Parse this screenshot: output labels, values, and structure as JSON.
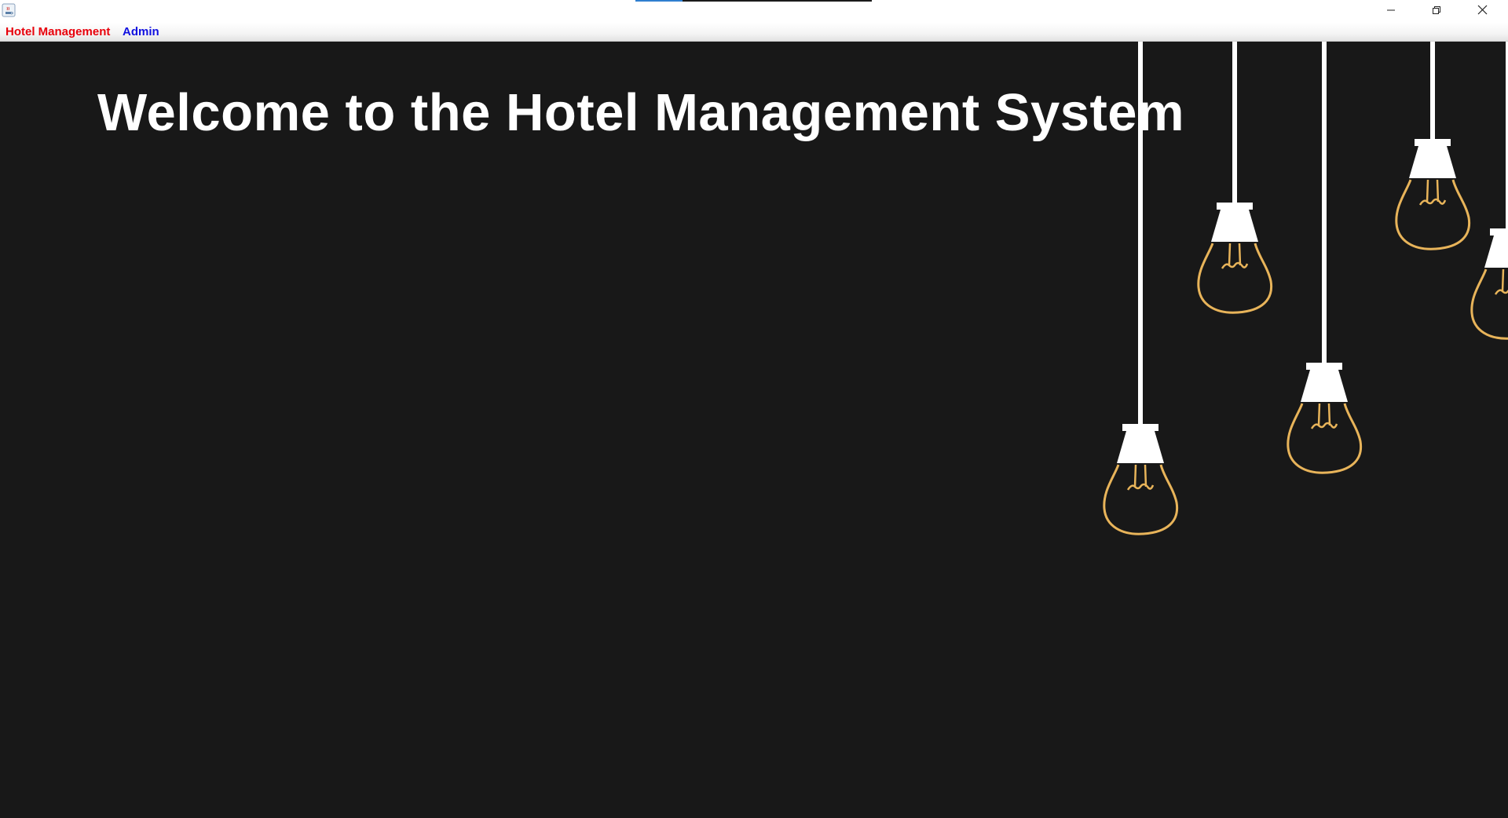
{
  "window": {
    "app_icon": "java-cup-icon",
    "loading_progress": 0.2,
    "controls": {
      "minimize_icon": "minimize-icon",
      "maximize_icon": "restore-icon",
      "close_icon": "close-icon"
    }
  },
  "menubar": {
    "items": [
      {
        "label": "Hotel Management",
        "color": "#e8000b"
      },
      {
        "label": "Admin",
        "color": "#1010e0"
      }
    ]
  },
  "main": {
    "welcome_text": "Welcome to the Hotel Management System",
    "welcome_color": "#ffffff",
    "background_color": "#181818",
    "decoration": "hanging-light-bulbs",
    "bulb_filament_color": "#e8b45a"
  }
}
